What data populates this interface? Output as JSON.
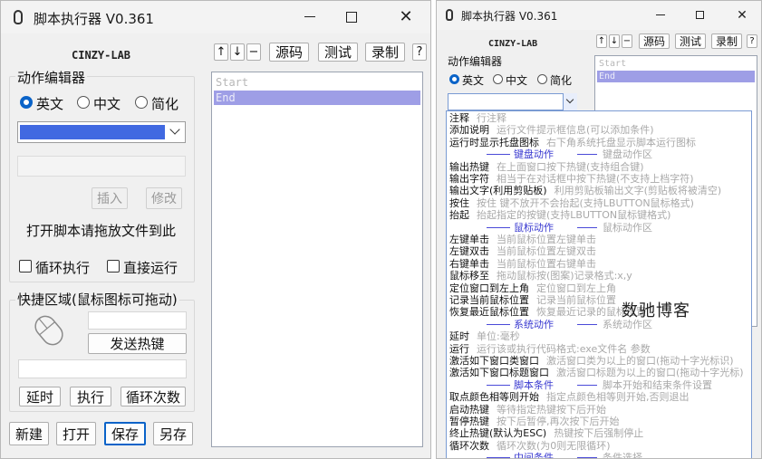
{
  "left": {
    "title": "脚本执行器 V0.361",
    "brand": "CINZY-LAB",
    "toolbar": {
      "up": "↑",
      "down": "↓",
      "minus": "−",
      "source": "源码",
      "test": "测试",
      "record": "录制",
      "help": "?"
    },
    "editor_group": "动作编辑器",
    "lang": {
      "en": "英文",
      "zh": "中文",
      "simple": "简化",
      "selected": "en"
    },
    "insert": "插入",
    "modify": "修改",
    "drop_hint": "打开脚本请拖放文件到此",
    "loop": "循环执行",
    "direct": "直接运行",
    "shortcut_group": "快捷区域(鼠标图标可拖动)",
    "send_hotkey": "发送热键",
    "delay": "延时",
    "exec": "执行",
    "loop_count": "循环次数",
    "new": "新建",
    "open": "打开",
    "save": "保存",
    "save_as": "另存",
    "list": [
      "Start",
      "End"
    ],
    "selected_index": 1
  },
  "right": {
    "title": "脚本执行器 V0.361",
    "brand": "CINZY-LAB",
    "toolbar": {
      "up": "↑",
      "down": "↓",
      "minus": "−",
      "source": "源码",
      "test": "测试",
      "record": "录制",
      "help": "?"
    },
    "editor_group": "动作编辑器",
    "lang": {
      "en": "英文",
      "zh": "中文",
      "simple": "简化"
    },
    "list": [
      "Start",
      "End"
    ],
    "selected_index": 1,
    "watermark": "数驰博客",
    "dropdown": [
      {
        "k": "item",
        "n": "注释",
        "d": "行注释"
      },
      {
        "k": "item",
        "n": "添加说明",
        "d": "运行文件提示框信息(可以添加条件)"
      },
      {
        "k": "item",
        "n": "运行时显示托盘图标",
        "d": "右下角系统托盘显示脚本运行图标"
      },
      {
        "k": "head",
        "n": "键盘动作",
        "d": "键盘动作区"
      },
      {
        "k": "item",
        "n": "输出热键",
        "d": "在上面窗口按下热键(支持组合键)"
      },
      {
        "k": "item",
        "n": "输出字符",
        "d": "相当于在对话框中按下热键(不支持上档字符)"
      },
      {
        "k": "item",
        "n": "输出文字(利用剪贴板)",
        "d": "利用剪贴板输出文字(剪贴板将被清空)"
      },
      {
        "k": "item",
        "n": "按住",
        "d": "按住 键不放开不会抬起(支持LBUTTON鼠标格式)"
      },
      {
        "k": "item",
        "n": "抬起",
        "d": "抬起指定的按键(支持LBUTTON鼠标键格式)"
      },
      {
        "k": "head",
        "n": "鼠标动作",
        "d": "鼠标动作区"
      },
      {
        "k": "item",
        "n": "左键单击",
        "d": "当前鼠标位置左键单击"
      },
      {
        "k": "item",
        "n": "左键双击",
        "d": "当前鼠标位置左键双击"
      },
      {
        "k": "item",
        "n": "右键单击",
        "d": "当前鼠标位置右键单击"
      },
      {
        "k": "item",
        "n": "鼠标移至",
        "d": "拖动鼠标按(图案)记录格式:x,y"
      },
      {
        "k": "item",
        "n": "定位窗口到左上角",
        "d": "定位窗口到左上角"
      },
      {
        "k": "item",
        "n": "记录当前鼠标位置",
        "d": "记录当前鼠标位置"
      },
      {
        "k": "item",
        "n": "恢复最近鼠标位置",
        "d": "恢复最近记录的鼠标位置"
      },
      {
        "k": "head",
        "n": "系统动作",
        "d": "系统动作区"
      },
      {
        "k": "item",
        "n": "延时",
        "d": "单位:毫秒"
      },
      {
        "k": "item",
        "n": "运行",
        "d": "运行该或执行代码格式:exe文件名 参数"
      },
      {
        "k": "item",
        "n": "激活如下窗口类窗口",
        "d": "激活窗口类为以上的窗口(拖动十字光标识)"
      },
      {
        "k": "item",
        "n": "激活如下窗口标题窗口",
        "d": "激活窗口标题为以上的窗口(拖动十字光标)"
      },
      {
        "k": "head",
        "n": "脚本条件",
        "d": "脚本开始和结束条件设置"
      },
      {
        "k": "item",
        "n": "取点颜色相等则开始",
        "d": "指定点颜色相等则开始,否则退出"
      },
      {
        "k": "item",
        "n": "启动热键",
        "d": "等待指定热键按下后开始"
      },
      {
        "k": "item",
        "n": "暂停热键",
        "d": "按下后暂停,再次按下后开始"
      },
      {
        "k": "item",
        "n": "终止热键(默认为ESC)",
        "d": "热键按下后强制停止"
      },
      {
        "k": "item",
        "n": "循环次数",
        "d": "循环次数(为0则无限循环)"
      },
      {
        "k": "head",
        "n": "中间条件",
        "d": "条件选择"
      }
    ]
  }
}
